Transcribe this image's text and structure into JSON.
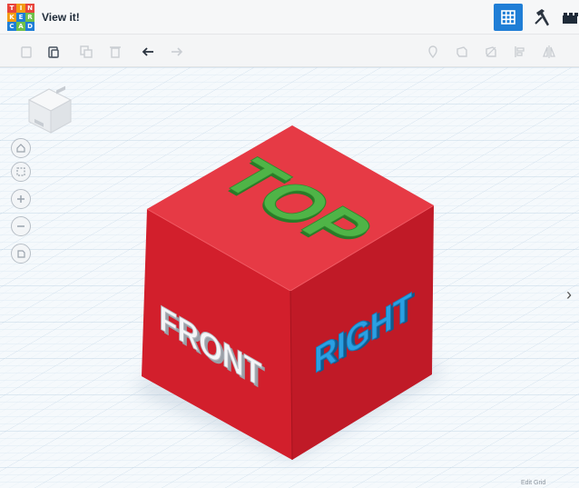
{
  "app": {
    "title": "View it!",
    "logo_letters": [
      "T",
      "I",
      "N",
      "K",
      "E",
      "R",
      "C",
      "A",
      "D"
    ],
    "logo_colors": [
      "#e8453c",
      "#f39c12",
      "#e8453c",
      "#f39c12",
      "#1f7ed6",
      "#6fc04a",
      "#1f7ed6",
      "#6fc04a",
      "#1f7ed6"
    ]
  },
  "header": {
    "grid_icon": "grid-view-icon",
    "hammer_icon": "hammer-icon",
    "blocks_icon": "bricks-icon",
    "accent_color": "#1f7ed6"
  },
  "toolbar": {
    "left_tools": [
      "copy-icon",
      "paste-icon",
      "duplicate-icon",
      "delete-icon",
      "undo-icon",
      "redo-icon"
    ],
    "right_tools": [
      "note-icon",
      "show-icon",
      "hide-icon",
      "align-icon",
      "mirror-icon"
    ]
  },
  "view_controls": [
    "home-view-icon",
    "fit-view-icon",
    "zoom-in-icon",
    "zoom-out-icon",
    "orthographic-icon"
  ],
  "scene": {
    "cube_color": "#d8222f",
    "top_text": "TOP",
    "top_color": "#3f9e3a",
    "front_text": "FRONT",
    "front_color": "#f2f3f5",
    "right_text": "RIGHT",
    "right_color": "#2196d9"
  },
  "footer": {
    "edit_grid_label": "Edit Grid",
    "expand_panel_symbol": "›"
  }
}
